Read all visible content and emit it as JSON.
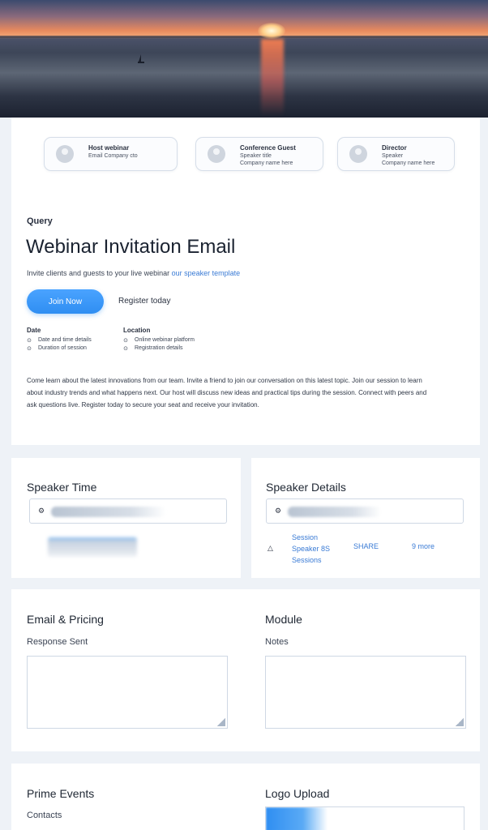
{
  "speakers": [
    {
      "name": "Host webinar",
      "line2": "Email Company cto",
      "line3": ""
    },
    {
      "name": "Conference Guest",
      "line2": "Speaker title",
      "line3": "Company name here"
    },
    {
      "name": "Director",
      "line2": "Speaker",
      "line3": "Company name here"
    }
  ],
  "page": {
    "eyebrow": "Query",
    "title": "Webinar Invitation Email",
    "subtitle_plain": "Invite clients and guests to your live webinar ",
    "subtitle_accent": "our speaker template",
    "primary_button": "Join Now",
    "secondary_link": "Register today"
  },
  "agenda": {
    "left": {
      "heading": "Date",
      "rows": [
        "Date and time details",
        "Duration of session"
      ]
    },
    "right": {
      "heading": "Location",
      "rows": [
        "Online webinar platform",
        "Registration details"
      ]
    }
  },
  "description": "Come learn about the latest innovations from our team. Invite a friend to join our conversation on this latest topic. Join our session to learn about industry trends and what happens next. Our host will discuss new ideas and practical tips during the session. Connect with peers and ask questions live. Register today to secure your seat and receive your invitation.",
  "speaker_time": {
    "title": "Speaker Time",
    "field_icon": "⚙"
  },
  "speaker_details": {
    "title": "Speaker Details",
    "field_icon": "⚙",
    "row_icon": "△",
    "links": [
      "Session",
      "Speaker 8S",
      "Sessions",
      "SHARE",
      "9 more"
    ]
  },
  "email": {
    "title": "Email & Pricing",
    "label": "Response Sent"
  },
  "module": {
    "title": "Module",
    "label": "Notes"
  },
  "prime": {
    "title": "Prime Events",
    "label": "Contacts"
  },
  "logo": {
    "title": "Logo Upload"
  }
}
